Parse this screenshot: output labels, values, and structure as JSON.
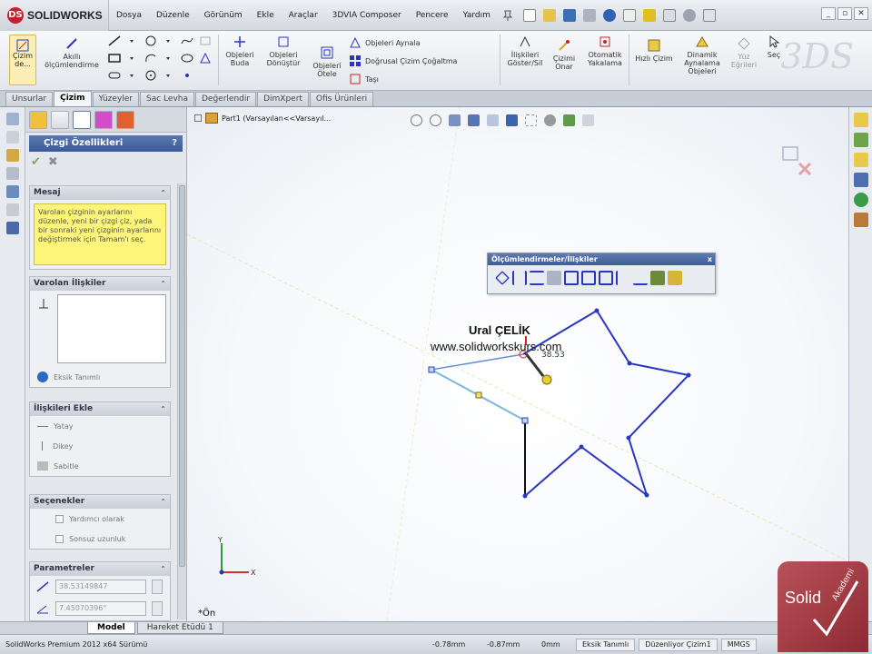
{
  "app": {
    "brand": "SOLIDWORKS",
    "menu": [
      "Dosya",
      "Düzenle",
      "Görünüm",
      "Ekle",
      "Araçlar",
      "3DVIA Composer",
      "Pencere",
      "Yardım"
    ]
  },
  "ribbon": {
    "sketch_btn": "Çizim\nde...",
    "smart_dim": "Akıllı\nölçümlendirme",
    "trim": "Objeleri\nBuda",
    "convert": "Objeleri\nDönüştür",
    "offset": "Objeleri\nÖtele",
    "mirror": "Objeleri Aynala",
    "linear_pattern": "Doğrusal Çizim Çoğaltma",
    "move": "Taşı",
    "display_delete": "İlişkileri\nGöster/Sil",
    "repair": "Çizimi\nOnar",
    "quick_snaps": "Otomatik\nYakalama",
    "rapid_sketch": "Hızlı Çizim",
    "dynamic_mirror": "Dinamik\nAynalama\nObjeleri",
    "face_curves": "Yüz\nEğrileri",
    "select": "Seç"
  },
  "tabs": [
    "Unsurlar",
    "Çizim",
    "Yüzeyler",
    "Sac Levha",
    "Değerlendir",
    "DimXpert",
    "Ofis Ürünleri"
  ],
  "panel": {
    "title": "Çizgi Özellikleri",
    "help": "?",
    "message_header": "Mesaj",
    "message_text": "Varolan çizginin ayarlarını düzenle, yeni bir çizgi çiz, yada bir sonraki yeni çizginin ayarlarını değiştirmek için Tamam'ı seç.",
    "existing_rel_header": "Varolan İlişkiler",
    "under_defined": "Eksik Tanımlı",
    "add_rel_header": "İlişkileri Ekle",
    "horizontal": "Yatay",
    "vertical": "Dikey",
    "fix": "Sabitle",
    "options_header": "Seçenekler",
    "for_construction": "Yardımcı olarak",
    "infinite_length": "Sonsuz uzunluk",
    "params_header": "Parametreler",
    "length_value": "38.53149847",
    "angle_value": "7.45070396°"
  },
  "canvas": {
    "tree_label": "Part1  (Varsayılan<<Varsayıl...",
    "view_label": "*Ön",
    "watermark_name": "Ural ÇELİK",
    "watermark_url": "www.solidworkskurs.com",
    "dim_value": "38.53",
    "axis_x": "X",
    "axis_y": "Y"
  },
  "floating_toolbar": {
    "title": "Ölçümlendirmeler/İlişkiler"
  },
  "bottom_tabs": [
    "Model",
    "Hareket Etüdü 1"
  ],
  "status": {
    "product": "SolidWorks Premium 2012 x64 Sürümü",
    "x": "-0.78mm",
    "y": "-0.87mm",
    "z": "0mm",
    "definition": "Eksik Tanımlı",
    "editing": "Düzenliyor Çizim1",
    "units": "MMGS"
  },
  "badge": {
    "solid": "Solid",
    "akademi": "Akademi"
  },
  "colors": {
    "sketch_line": "#2b36c0",
    "accent": "#3b5a95",
    "message_bg": "#fdf57a"
  }
}
